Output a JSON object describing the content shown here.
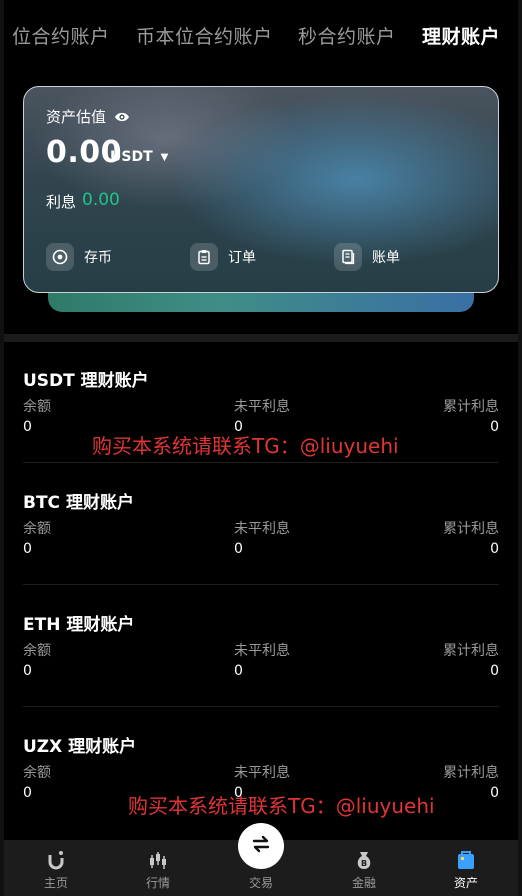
{
  "tabs": [
    {
      "label": "位合约账户",
      "active": false
    },
    {
      "label": "币本位合约账户",
      "active": false
    },
    {
      "label": "秒合约账户",
      "active": false
    },
    {
      "label": "理财账户",
      "active": true
    }
  ],
  "asset_card": {
    "label": "资产估值",
    "amount": "0.00",
    "unit": "USDT",
    "interest_label": "利息",
    "interest_value": "0.00",
    "actions": [
      {
        "label": "存币",
        "icon": "deposit-icon"
      },
      {
        "label": "订单",
        "icon": "order-icon"
      },
      {
        "label": "账单",
        "icon": "bill-icon"
      }
    ]
  },
  "accounts": [
    {
      "title": "USDT 理财账户",
      "balance_label": "余额",
      "balance": "0",
      "unsettled_label": "未平利息",
      "unsettled": "0",
      "cumulative_label": "累计利息",
      "cumulative": "0"
    },
    {
      "title": "BTC 理财账户",
      "balance_label": "余额",
      "balance": "0",
      "unsettled_label": "未平利息",
      "unsettled": "0",
      "cumulative_label": "累计利息",
      "cumulative": "0"
    },
    {
      "title": "ETH 理财账户",
      "balance_label": "余额",
      "balance": "0",
      "unsettled_label": "未平利息",
      "unsettled": "0",
      "cumulative_label": "累计利息",
      "cumulative": "0"
    },
    {
      "title": "UZX 理财账户",
      "balance_label": "余额",
      "balance": "0",
      "unsettled_label": "未平利息",
      "unsettled": "0",
      "cumulative_label": "累计利息",
      "cumulative": "0"
    }
  ],
  "watermarks": [
    "购买本系统请联系TG：@liuyuehi",
    "购买本系统请联系TG：@liuyuehi"
  ],
  "bottom_nav": [
    {
      "label": "主页",
      "icon": "home-icon",
      "active": false
    },
    {
      "label": "行情",
      "icon": "market-icon",
      "active": false
    },
    {
      "label": "交易",
      "icon": "trade-icon",
      "active": false
    },
    {
      "label": "金融",
      "icon": "finance-icon",
      "active": false
    },
    {
      "label": "资产",
      "icon": "assets-icon",
      "active": true
    }
  ],
  "colors": {
    "accent_green": "#1ec58c",
    "watermark_red": "#e03535",
    "background": "#000000"
  }
}
